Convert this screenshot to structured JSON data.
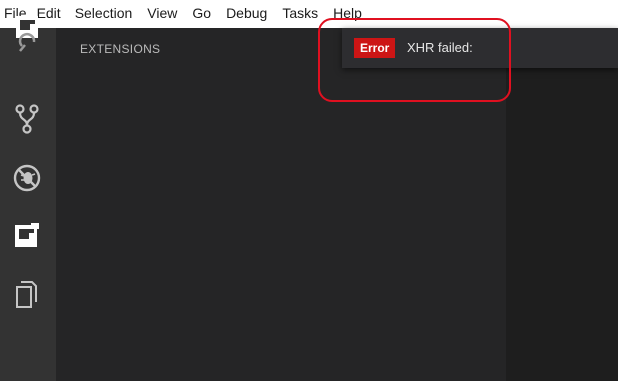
{
  "menubar": {
    "items": [
      "File",
      "Edit",
      "Selection",
      "View",
      "Go",
      "Debug",
      "Tasks",
      "Help"
    ]
  },
  "activitybar": {
    "icons": [
      "explorer-icon",
      "search-icon",
      "source-control-icon",
      "debug-icon",
      "extensions-icon",
      "files-icon"
    ]
  },
  "sidebar": {
    "title": "EXTENSIONS"
  },
  "notification": {
    "badge": "Error",
    "message": "XHR failed:"
  },
  "colors": {
    "menubar_bg": "#ffffff",
    "activitybar_bg": "#333333",
    "sidebar_bg": "#252526",
    "editor_bg": "#1e1e1e",
    "notification_bg": "#2d2d30",
    "error_badge": "#cc1515",
    "highlight": "#e01020"
  }
}
